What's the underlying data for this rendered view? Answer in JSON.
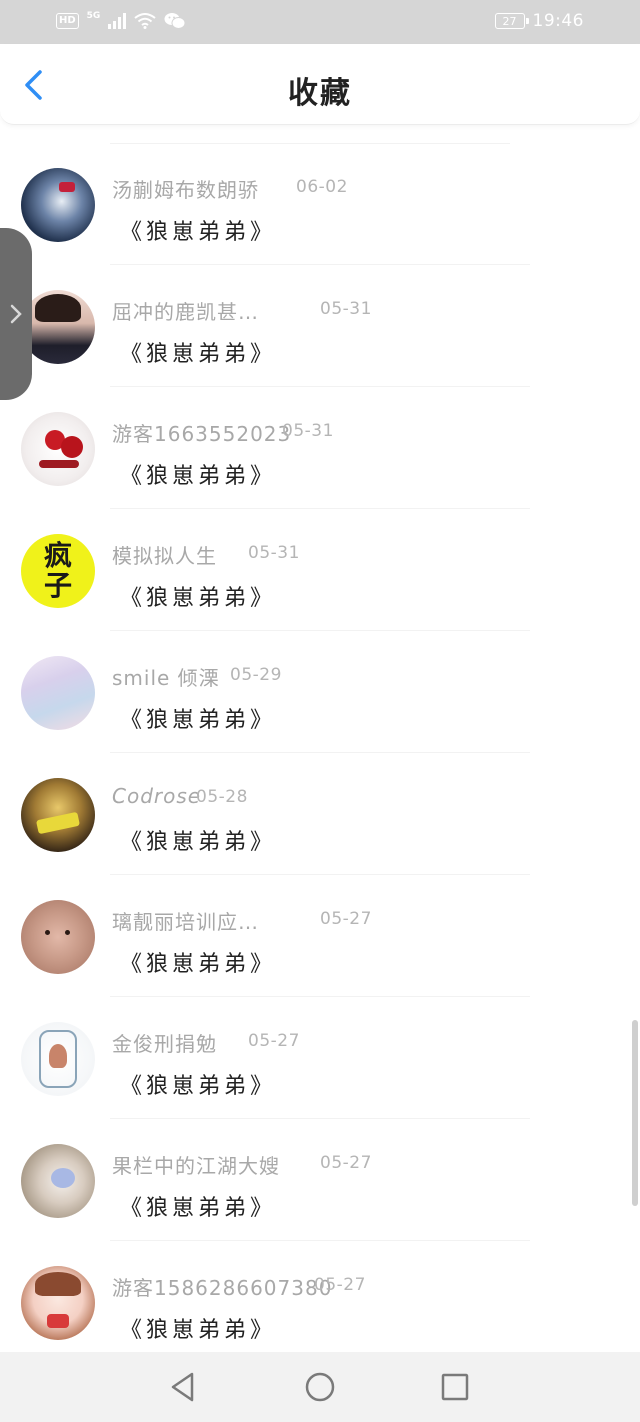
{
  "status_bar": {
    "left_badges": [
      "HD",
      "5G"
    ],
    "battery": "27",
    "time": "19:46",
    "icons": [
      "hd-icon",
      "signal-icon",
      "wifi-icon",
      "wechat-icon",
      "battery-icon"
    ]
  },
  "header": {
    "title": "收藏",
    "back_icon": "chevron-left-icon",
    "accent_color": "#2f8ef5"
  },
  "items": [
    {
      "name": "汤蒯姆布数朗骄",
      "date": "06-02",
      "title": "《狼崽弟弟》"
    },
    {
      "name": "屈冲的鹿凯甚…",
      "date": "05-31",
      "title": "《狼崽弟弟》"
    },
    {
      "name": "游客1663552023",
      "date": "05-31",
      "title": "《狼崽弟弟》"
    },
    {
      "name": "模拟拟人生",
      "date": "05-31",
      "title": "《狼崽弟弟》",
      "avatar_text": "疯子"
    },
    {
      "name": "smile 倾溧",
      "date": "05-29",
      "title": "《狼崽弟弟》"
    },
    {
      "name": "Codrose",
      "date": "05-28",
      "title": "《狼崽弟弟》"
    },
    {
      "name": "璃靓丽培训应…",
      "date": "05-27",
      "title": "《狼崽弟弟》"
    },
    {
      "name": "金俊刑捐勉",
      "date": "05-27",
      "title": "《狼崽弟弟》"
    },
    {
      "name": "果栏中的江湖大嫂",
      "date": "05-27",
      "title": "《狼崽弟弟》"
    },
    {
      "name": "游客1586286607380",
      "date": "05-27",
      "title": "《狼崽弟弟》"
    }
  ],
  "nav_bar": {
    "icons": [
      "back-triangle-icon",
      "home-circle-icon",
      "recents-square-icon"
    ]
  }
}
